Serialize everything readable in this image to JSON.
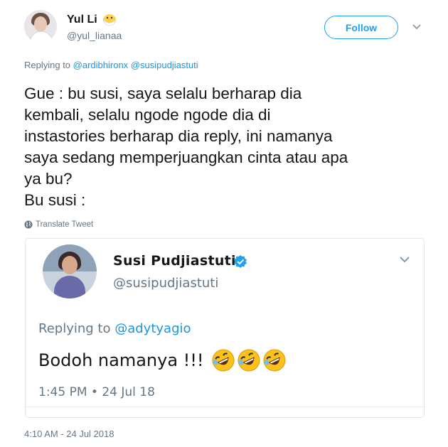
{
  "author": {
    "display_name": "Yul Li",
    "username": "@yul_lianaa",
    "name_emoji": "chick-icon"
  },
  "follow_button": {
    "label": "Follow"
  },
  "reply_context": {
    "prefix": "Replying to",
    "handles": [
      "@ardibhironx",
      "@susipudjiastuti"
    ]
  },
  "tweet": {
    "text": "Gue : bu susi, saya selalu berharap dia\nkembali, selalu ngode ngode dia di\ninstastories berharap dia reply, ini namanya\nsaya sedang memperjuangkan cinta atau apa\nya bu?\nBu susi :"
  },
  "translate": {
    "label": "Translate Tweet",
    "icon": "globe-icon"
  },
  "embedded_tweet": {
    "display_name": "Susi Pudjiastuti",
    "username": "@susipudjiastuti",
    "verified": true,
    "reply_prefix": "Replying to",
    "reply_handle": "@adytyagio",
    "text": "Bodoh namanya !!!",
    "emoji": [
      "rolling-on-floor-laughing-icon",
      "rolling-on-floor-laughing-icon",
      "rolling-on-floor-laughing-icon"
    ],
    "time": "1:45 PM • 24 Jul 18"
  },
  "timestamp": "4:10 AM - 24 Jul 2018",
  "colors": {
    "accent": "#1da1f2",
    "link": "#1b95e0",
    "muted": "#657786",
    "text": "#14171a"
  }
}
